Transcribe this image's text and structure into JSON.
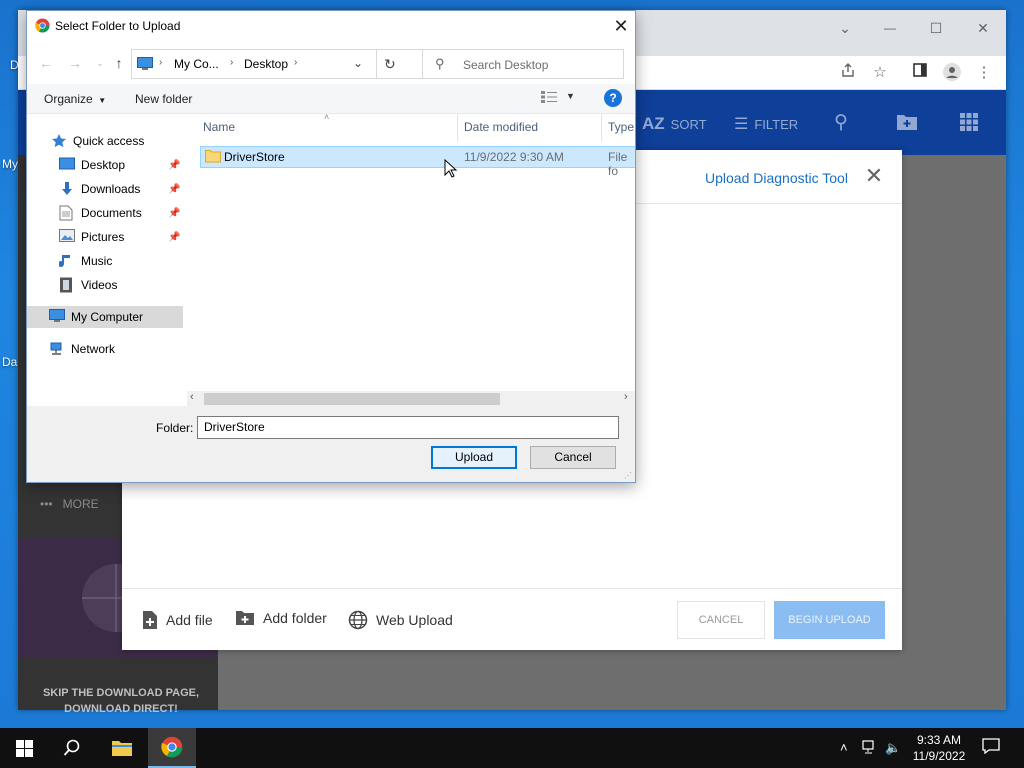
{
  "desktop": {
    "fragments": [
      "D",
      "My",
      "Da"
    ]
  },
  "browser": {
    "window_controls": {
      "dropdown": "⌄",
      "minimize": "—",
      "maximize": "☐",
      "close": "✕"
    }
  },
  "site": {
    "header": {
      "sort_label": "SORT",
      "filter_label": "FILTER",
      "az_glyph": "AZ"
    },
    "more_label": "MORE",
    "skip_text": "SKIP THE DOWNLOAD PAGE, DOWNLOAD DIRECT!"
  },
  "upload_modal": {
    "title": "Upload Diagnostic Tool",
    "add_file": "Add file",
    "add_folder": "Add folder",
    "web_upload": "Web Upload",
    "cancel": "CANCEL",
    "begin_upload": "BEGIN UPLOAD"
  },
  "dialog": {
    "title": "Select Folder to Upload",
    "breadcrumb": [
      "My Co...",
      "Desktop"
    ],
    "search_placeholder": "Search Desktop",
    "organize": "Organize",
    "new_folder": "New folder",
    "nav": {
      "quick_access": "Quick access",
      "items": [
        "Desktop",
        "Downloads",
        "Documents",
        "Pictures",
        "Music",
        "Videos"
      ],
      "my_computer": "My Computer",
      "network": "Network"
    },
    "columns": {
      "name": "Name",
      "date_modified": "Date modified",
      "type": "Type"
    },
    "files": [
      {
        "name": "DriverStore",
        "date": "11/9/2022 9:30 AM",
        "type": "File fo"
      }
    ],
    "folder_label": "Folder:",
    "folder_value": "DriverStore",
    "upload_btn": "Upload",
    "cancel_btn": "Cancel"
  },
  "taskbar": {
    "time": "9:33 AM",
    "date": "11/9/2022"
  },
  "colors": {
    "desktop_blue": "#1a7bd6",
    "site_header": "#0e3f99",
    "accent_link": "#1a6fc4",
    "begin_upload": "#8bbdf2",
    "selection": "#cce8ff"
  }
}
